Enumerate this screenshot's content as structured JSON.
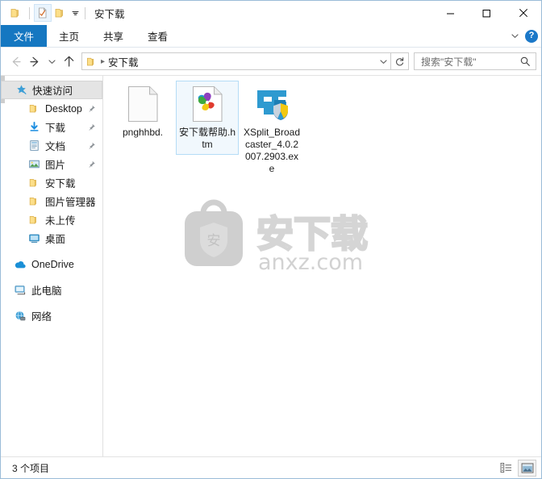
{
  "window": {
    "title": "安下载",
    "minimize_label": "最小化",
    "maximize_label": "最大化",
    "close_label": "关闭"
  },
  "quick_access_toolbar": {
    "items": [
      {
        "name": "folder-icon",
        "label": "属性菜单"
      },
      {
        "name": "properties-icon",
        "label": "属性"
      },
      {
        "name": "new-folder-icon",
        "label": "新建文件夹"
      }
    ],
    "customize_label": "自定义快速访问工具栏"
  },
  "ribbon": {
    "tabs": [
      {
        "id": "file",
        "label": "文件"
      },
      {
        "id": "home",
        "label": "主页"
      },
      {
        "id": "share",
        "label": "共享"
      },
      {
        "id": "view",
        "label": "查看"
      }
    ],
    "active_tab": "文件",
    "collapse_label": "展开功能区",
    "help_label": "?",
    "accent_color": "#1577c1"
  },
  "navigation": {
    "back_label": "后退",
    "forward_label": "前进",
    "recent_label": "最近浏览的位置",
    "up_label": "上移一级",
    "breadcrumb": [
      {
        "label": "安下载"
      }
    ],
    "address_dropdown_label": "以前的位置",
    "refresh_label": "刷新",
    "search": {
      "placeholder": "搜索\"安下载\"",
      "value": ""
    }
  },
  "sidebar": {
    "items": [
      {
        "label": "快速访问",
        "icon": "star-pin-icon",
        "level": 0,
        "selected": true,
        "pinned": false
      },
      {
        "label": "Desktop",
        "icon": "folder-icon",
        "level": 1,
        "selected": false,
        "pinned": true
      },
      {
        "label": "下载",
        "icon": "downloads-icon",
        "level": 1,
        "selected": false,
        "pinned": true
      },
      {
        "label": "文档",
        "icon": "documents-icon",
        "level": 1,
        "selected": false,
        "pinned": true
      },
      {
        "label": "图片",
        "icon": "pictures-icon",
        "level": 1,
        "selected": false,
        "pinned": true
      },
      {
        "label": "安下载",
        "icon": "folder-icon",
        "level": 1,
        "selected": false,
        "pinned": false
      },
      {
        "label": "图片管理器",
        "icon": "folder-icon",
        "level": 1,
        "selected": false,
        "pinned": false
      },
      {
        "label": "未上传",
        "icon": "folder-icon",
        "level": 1,
        "selected": false,
        "pinned": false
      },
      {
        "label": "桌面",
        "icon": "desktop-icon",
        "level": 1,
        "selected": false,
        "pinned": false
      },
      {
        "label": "OneDrive",
        "icon": "onedrive-icon",
        "level": 0,
        "selected": false,
        "pinned": false
      },
      {
        "label": "此电脑",
        "icon": "this-pc-icon",
        "level": 0,
        "selected": false,
        "pinned": false
      },
      {
        "label": "网络",
        "icon": "network-icon",
        "level": 0,
        "selected": false,
        "pinned": false
      }
    ]
  },
  "files": [
    {
      "name": "pnghhbd.",
      "icon": "blank-document-icon",
      "selected": false
    },
    {
      "name": "安下载帮助.htm",
      "icon": "chrome-html-icon",
      "selected": true
    },
    {
      "name": "XSplit_Broadcaster_4.0.2007.2903.exe",
      "icon": "xsplit-exe-icon",
      "selected": false
    }
  ],
  "watermark": {
    "text": "安下载",
    "url": "anxz.com"
  },
  "statusbar": {
    "item_count": "3 个项目",
    "views": [
      {
        "id": "details",
        "label": "详细信息",
        "active": false
      },
      {
        "id": "large-icons",
        "label": "大图标",
        "active": true
      }
    ]
  }
}
